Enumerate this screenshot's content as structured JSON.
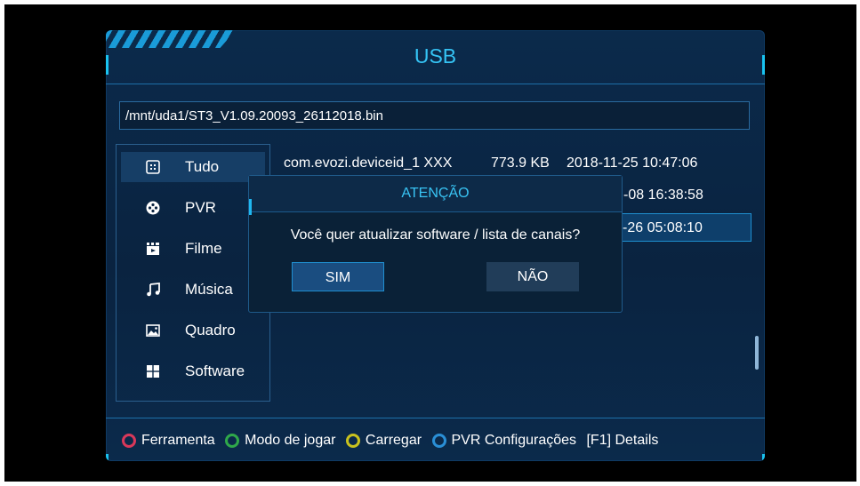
{
  "window": {
    "title": "USB"
  },
  "path": "/mnt/uda1/ST3_V1.09.20093_26112018.bin",
  "sidebar": {
    "items": [
      {
        "label": "Tudo",
        "icon": "grid-icon",
        "active": true
      },
      {
        "label": "PVR",
        "icon": "film-reel-icon"
      },
      {
        "label": "Filme",
        "icon": "clapperboard-icon"
      },
      {
        "label": "Música",
        "icon": "music-note-icon"
      },
      {
        "label": "Quadro",
        "icon": "picture-icon"
      },
      {
        "label": "Software",
        "icon": "windows-icon"
      }
    ]
  },
  "files": [
    {
      "name": "com.evozi.deviceid_1 XXX",
      "size": "773.9 KB",
      "date": "2018-11-25 10:47:06"
    },
    {
      "date": "-08 16:38:58"
    },
    {
      "date": "-26 05:08:10",
      "selected": true
    }
  ],
  "dialog": {
    "title": "ATENÇÃO",
    "message": "Você quer atualizar software / lista de canais?",
    "yes_label": "SIM",
    "no_label": "NÃO"
  },
  "footer": [
    {
      "label": "Ferramenta",
      "color": "#d9385a"
    },
    {
      "label": "Modo de jogar",
      "color": "#2fa84a"
    },
    {
      "label": "Carregar",
      "color": "#c9c21e"
    },
    {
      "label": "PVR Configurações",
      "color": "#2a8fd6"
    },
    {
      "label": "[F1] Details"
    }
  ],
  "colors": {
    "accent": "#35c4f5",
    "panel": "#0b2a4b"
  }
}
